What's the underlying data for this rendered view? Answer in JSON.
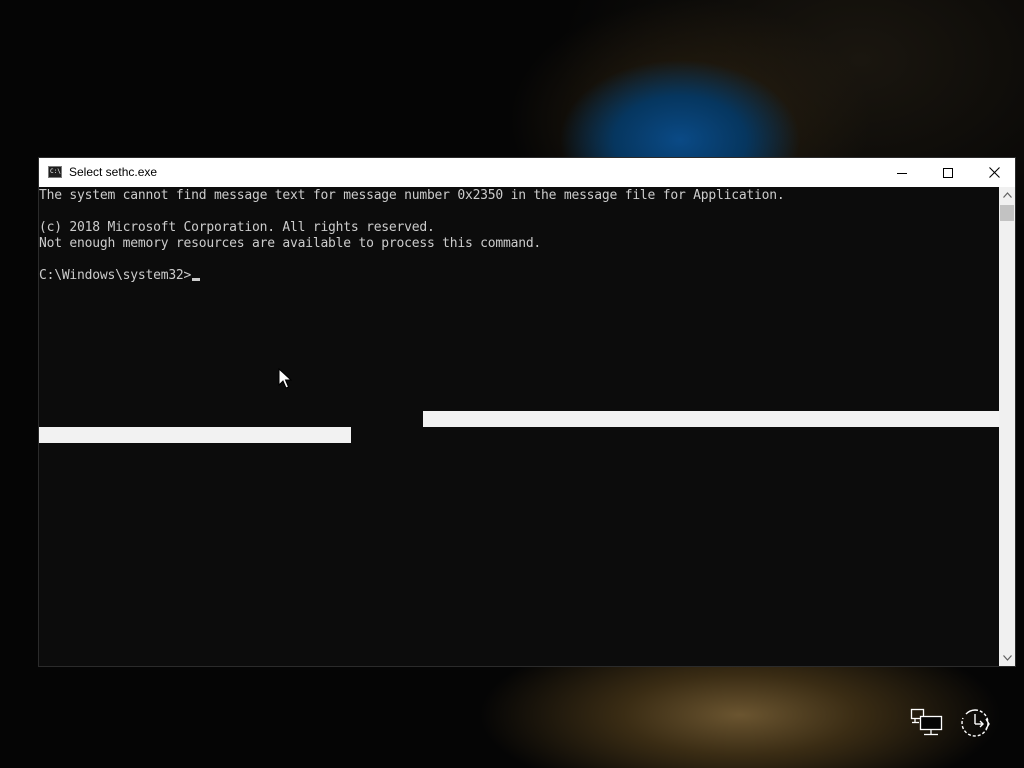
{
  "window": {
    "title": "Select sethc.exe",
    "icon": "cmd-icon",
    "icon_glyph": "C:\\",
    "controls": {
      "minimize": "minimize-icon",
      "maximize": "maximize-icon",
      "close": "close-icon"
    }
  },
  "console": {
    "lines": [
      "The system cannot find message text for message number 0x2350 in the message file for Application.",
      "",
      "(c) 2018 Microsoft Corporation. All rights reserved.",
      "Not enough memory resources are available to process this command.",
      "",
      "C:\\Windows\\system32>"
    ],
    "prompt": "C:\\Windows\\system32>"
  },
  "scrollbar": {
    "up": "chevron-up-icon",
    "down": "chevron-down-icon"
  },
  "tray": {
    "network": "network-icon",
    "ease_of_access": "ease-of-access-icon"
  },
  "colors": {
    "console_background": "#0c0c0c",
    "console_text": "#cccccc",
    "titlebar": "#ffffff",
    "selection_bar": "#f2f2f2"
  }
}
